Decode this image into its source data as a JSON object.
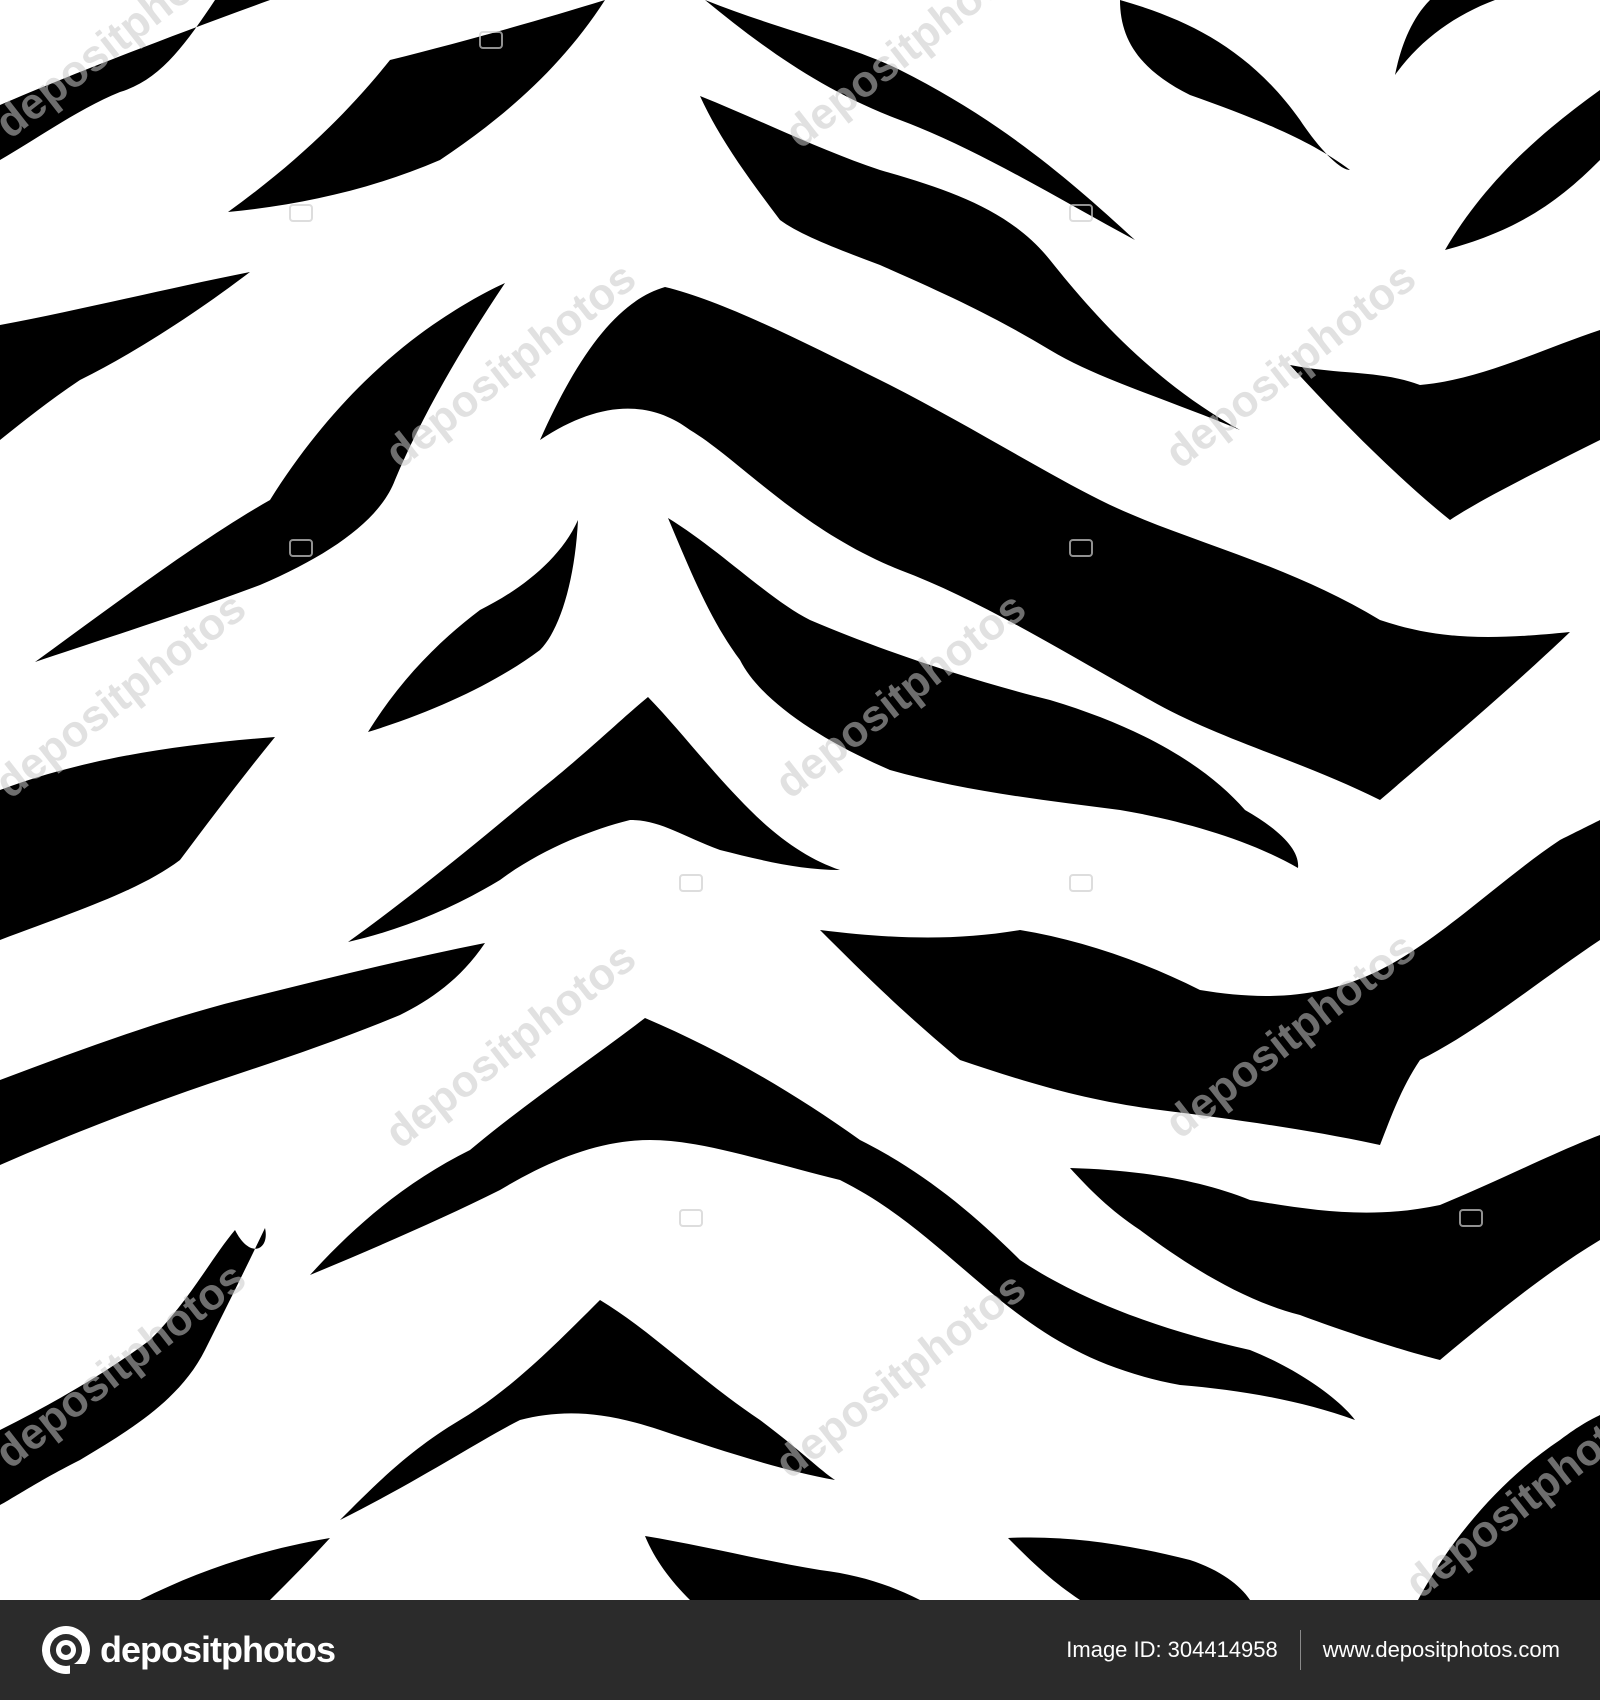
{
  "image": {
    "subject": "zebra-stripe-pattern",
    "colors": {
      "stripe": "#000000",
      "background": "#ffffff",
      "watermark": "#c8c8c8"
    },
    "watermark_text": "depositphotos"
  },
  "footer": {
    "background": "#2b2b2b",
    "brand_icon": "depositphotos-logo-icon",
    "brand_name": "depositphotos",
    "image_id_label": "Image ID:",
    "image_id_value": "304414958",
    "website": "www.depositphotos.com"
  }
}
